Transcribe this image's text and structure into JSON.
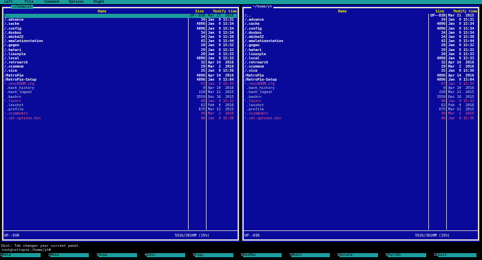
{
  "menubar": [
    "Left",
    "File",
    "Command",
    "Options",
    "Right"
  ],
  "left_panel": {
    "path": "~/home/yt",
    "header": {
      "name": "Name",
      "size": "Size",
      "mtime": "Modify time"
    },
    "rows": [
      {
        "name": "/..",
        "size": "UP--DIR",
        "time": "Mar 21  2015",
        "cls": "cursel"
      },
      {
        "name": "/.advance",
        "size": "34",
        "time": "Jan  9 15:31",
        "cls": "dir"
      },
      {
        "name": "/.cache",
        "size": "4096",
        "time": "Jan  9 15:34",
        "cls": "dir"
      },
      {
        "name": "/.config",
        "size": "4096",
        "time": "Jan  9 15:34",
        "cls": "dir"
      },
      {
        "name": "/.dosbox",
        "size": "34",
        "time": "Jan  9 15:34",
        "cls": "dir"
      },
      {
        "name": "/.ebike32",
        "size": "34",
        "time": "Jan  9 15:30",
        "cls": "dir"
      },
      {
        "name": "/.emulationstation",
        "size": "42",
        "time": "Jan  9 15:44",
        "cls": "dir"
      },
      {
        "name": "/.gngeo",
        "size": "20",
        "time": "Jan  9 15:32",
        "cls": "dir"
      },
      {
        "name": "/.hatari",
        "size": "29",
        "time": "Jan  9 15:32",
        "cls": "dir"
      },
      {
        "name": "/.linuxple",
        "size": "20",
        "time": "Jan  9 15:33",
        "cls": "dir"
      },
      {
        "name": "/.local",
        "size": "4096",
        "time": "Jan  9 15:33",
        "cls": "dir"
      },
      {
        "name": "/.retroarch",
        "size": "32",
        "time": "Apr 14  2016",
        "cls": "dir"
      },
      {
        "name": "/.scummvm",
        "size": "29",
        "time": "Mar  2  2016",
        "cls": "dir"
      },
      {
        "name": "/.vice",
        "size": "25",
        "time": "Jan  9 15:36",
        "cls": "dir"
      },
      {
        "name": "/RetroPie",
        "size": "4096",
        "time": "Apr 14  2016",
        "cls": "dir"
      },
      {
        "name": "/RetroPie-Setup",
        "size": "4096",
        "time": "Jan  9 15:04",
        "cls": "dir"
      },
      {
        "name": "!.chocDOOM.cfg",
        "size": "67",
        "time": "Jan  9 15:35",
        "cls": "pink"
      },
      {
        "name": " .bash_history",
        "size": "0",
        "time": "Apr 14  2016",
        "cls": "hid"
      },
      {
        "name": " .bash_logout",
        "size": "220",
        "time": "Mar 21  2015",
        "cls": "hid"
      },
      {
        "name": " .bashrc",
        "size": "3559",
        "time": "Dec 16  2015",
        "cls": "hid"
      },
      {
        "name": "!.fuzzrc",
        "size": "46",
        "time": "Jan  9 15:32",
        "cls": "pink"
      },
      {
        "name": " .lesshst",
        "size": "62",
        "time": "Feb  4  2016",
        "cls": "hid"
      },
      {
        "name": " .profile",
        "size": "675",
        "time": "Mar 21  2015",
        "cls": "hid"
      },
      {
        "name": "!.scummvmrc",
        "size": "39",
        "time": "Mar  2  2016",
        "cls": "pink"
      },
      {
        "name": "!.sdl-options.bin",
        "size": "96",
        "time": "Jan  9 15:36",
        "cls": "pink"
      }
    ],
    "footer_left": "UP--DIR",
    "footer_right": "552G/3620M (15%)"
  },
  "right_panel": {
    "path": "~/home/yt",
    "header": {
      "name": "Name",
      "size": "Size",
      "mtime": "Modify time"
    },
    "rows": [
      {
        "name": "/..",
        "size": "UP--DIR",
        "time": "Mar 21  2015",
        "cls": "dir"
      },
      {
        "name": "/.advance",
        "size": "34",
        "time": "Jan  9 15:31",
        "cls": "dir"
      },
      {
        "name": "/.cache",
        "size": "4096",
        "time": "Jan  9 15:34",
        "cls": "dir"
      },
      {
        "name": "/.config",
        "size": "4096",
        "time": "Jan  9 15:34",
        "cls": "dir"
      },
      {
        "name": "/.dosbox",
        "size": "34",
        "time": "Jan  9 15:34",
        "cls": "dir"
      },
      {
        "name": "/.ebike32",
        "size": "34",
        "time": "Jan  9 15:30",
        "cls": "dir"
      },
      {
        "name": "/.emulationstation",
        "size": "42",
        "time": "Jan  9 15:44",
        "cls": "dir"
      },
      {
        "name": "/.gngeo",
        "size": "20",
        "time": "Jan  9 15:32",
        "cls": "dir"
      },
      {
        "name": "/.hatari",
        "size": "29",
        "time": "Jan  9 15:32",
        "cls": "dir"
      },
      {
        "name": "/.linuxple",
        "size": "20",
        "time": "Jan  9 15:33",
        "cls": "dir"
      },
      {
        "name": "/.local",
        "size": "4096",
        "time": "Jan  9 15:33",
        "cls": "dir"
      },
      {
        "name": "/.retroarch",
        "size": "32",
        "time": "Apr 14  2016",
        "cls": "dir"
      },
      {
        "name": "/.scummvm",
        "size": "29",
        "time": "Mar  2  2016",
        "cls": "dir"
      },
      {
        "name": "/.vice",
        "size": "25",
        "time": "Jan  9 15:36",
        "cls": "dir"
      },
      {
        "name": "/RetroPie",
        "size": "4096",
        "time": "Apr 14  2016",
        "cls": "dir"
      },
      {
        "name": "/RetroPie-Setup",
        "size": "4096",
        "time": "Jan  9 15:04",
        "cls": "dir"
      },
      {
        "name": "!.chocDOOM.cfg",
        "size": "67",
        "time": "Jan  9 15:35",
        "cls": "pink"
      },
      {
        "name": " .bash_history",
        "size": "0",
        "time": "Apr 14  2016",
        "cls": "hid"
      },
      {
        "name": " .bash_logout",
        "size": "220",
        "time": "Mar 21  2015",
        "cls": "hid"
      },
      {
        "name": " .bashrc",
        "size": "3559",
        "time": "Dec 16  2015",
        "cls": "hid"
      },
      {
        "name": "!.fuzzrc",
        "size": "46",
        "time": "Jan  9 15:32",
        "cls": "pink"
      },
      {
        "name": " .lesshst",
        "size": "62",
        "time": "Feb  4  2016",
        "cls": "hid"
      },
      {
        "name": " .profile",
        "size": "675",
        "time": "Mar 21  2015",
        "cls": "hid"
      },
      {
        "name": "!.scummvmrc",
        "size": "39",
        "time": "Mar  2  2016",
        "cls": "pink"
      },
      {
        "name": "!.sdl-options.bin",
        "size": "96",
        "time": "Jan  9 15:36",
        "cls": "pink"
      }
    ],
    "footer_left": "UP--DIR",
    "footer_right": "552G/3620M (15%)"
  },
  "hint": "Hint: Tab changes your current panel.",
  "prompt": "root@retropie:/home/yt#",
  "fkeys": [
    {
      "num": "1",
      "label": "Help"
    },
    {
      "num": "2",
      "label": "Menu"
    },
    {
      "num": "3",
      "label": "View"
    },
    {
      "num": "4",
      "label": "Edit"
    },
    {
      "num": "5",
      "label": "Copy"
    },
    {
      "num": "6",
      "label": "RenMov"
    },
    {
      "num": "7",
      "label": "Mkdir"
    },
    {
      "num": "8",
      "label": "Delete"
    },
    {
      "num": "9",
      "label": "PullDn"
    },
    {
      "num": "10",
      "label": "Quit"
    }
  ]
}
